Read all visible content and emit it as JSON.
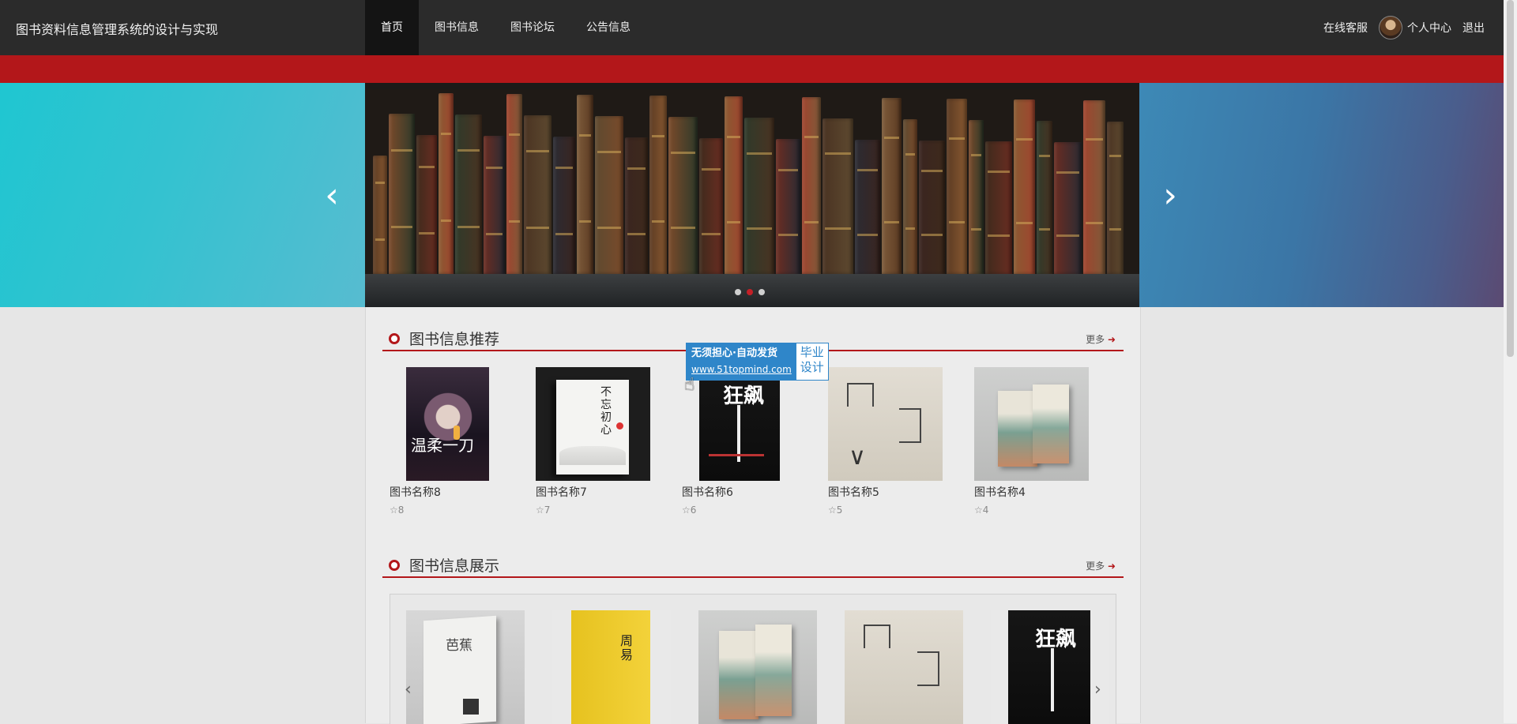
{
  "header": {
    "site_title": "图书资料信息管理系统的设计与实现",
    "nav": [
      {
        "label": "首页",
        "active": true
      },
      {
        "label": "图书信息",
        "active": false
      },
      {
        "label": "图书论坛",
        "active": false
      },
      {
        "label": "公告信息",
        "active": false
      }
    ],
    "service_label": "在线客服",
    "personal_label": "个人中心",
    "logout_label": "退出"
  },
  "banner": {
    "prev_icon": "chevron-left-icon",
    "next_icon": "chevron-right-icon",
    "slide_count": 3,
    "active_slide": 2
  },
  "recommend": {
    "title": "图书信息推荐",
    "more_label": "更多",
    "items": [
      {
        "name": "图书名称8",
        "rating": "8",
        "cover_text": "温柔一刀"
      },
      {
        "name": "图书名称7",
        "rating": "7",
        "cover_text": "不忘初心"
      },
      {
        "name": "图书名称6",
        "rating": "6",
        "cover_text": "狂飙"
      },
      {
        "name": "图书名称5",
        "rating": "5",
        "cover_text": ""
      },
      {
        "name": "图书名称4",
        "rating": "4",
        "cover_text": ""
      }
    ]
  },
  "showcase": {
    "title": "图书信息展示",
    "more_label": "更多",
    "items": [
      {
        "cover_text": "芭蕉"
      },
      {
        "cover_text": "周易"
      },
      {
        "cover_text": ""
      },
      {
        "cover_text": ""
      },
      {
        "cover_text": "狂飙"
      }
    ]
  },
  "watermark": {
    "line1": "无须担心·自动发货",
    "line2": "www.51topmind.com",
    "side1": "毕业",
    "side2": "设计"
  },
  "colors": {
    "accent_red": "#b3171a",
    "nav_bg": "#2b2b2b",
    "badge_blue": "#2f86c9"
  }
}
